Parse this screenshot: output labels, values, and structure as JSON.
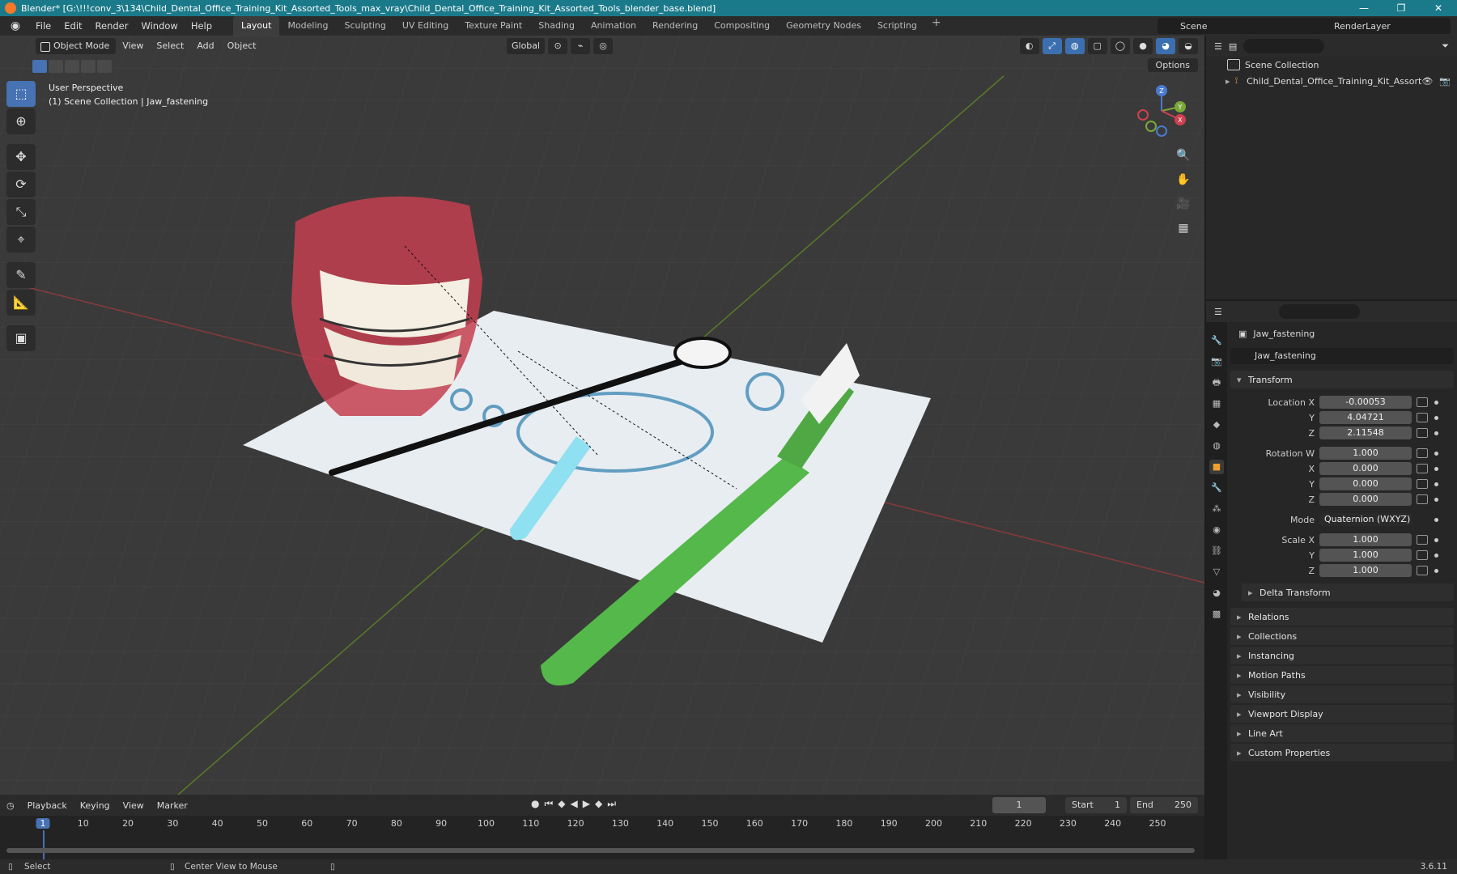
{
  "window": {
    "title": "Blender* [G:\\!!!conv_3\\134\\Child_Dental_Office_Training_Kit_Assorted_Tools_max_vray\\Child_Dental_Office_Training_Kit_Assorted_Tools_blender_base.blend]",
    "controls": [
      "—",
      "❐",
      "✕"
    ]
  },
  "menu": [
    "File",
    "Edit",
    "Render",
    "Window",
    "Help"
  ],
  "workspaces": [
    "Layout",
    "Modeling",
    "Sculpting",
    "UV Editing",
    "Texture Paint",
    "Shading",
    "Animation",
    "Rendering",
    "Compositing",
    "Geometry Nodes",
    "Scripting"
  ],
  "scene_name": "Scene",
  "render_layer": "RenderLayer",
  "viewport": {
    "mode": "Object Mode",
    "menus": [
      "View",
      "Select",
      "Add",
      "Object"
    ],
    "orientation": "Global",
    "options": "Options",
    "perspective": "User Perspective",
    "collection_info": "(1) Scene Collection | Jaw_fastening",
    "gizmo_axes": [
      "X",
      "Y",
      "Z"
    ]
  },
  "outliner": {
    "root": "Scene Collection",
    "items": [
      "Child_Dental_Office_Training_Kit_Assort"
    ]
  },
  "properties": {
    "object_name": "Jaw_fastening",
    "data_name": "Jaw_fastening",
    "transform_title": "Transform",
    "location_label": "Location X",
    "location": [
      "-0.00053",
      "4.04721",
      "2.11548"
    ],
    "rotation_label": "Rotation W",
    "rotation": [
      "1.000",
      "0.000",
      "0.000",
      "0.000"
    ],
    "mode_label": "Mode",
    "mode_value": "Quaternion (WXYZ)",
    "scale_label": "Scale X",
    "scale": [
      "1.000",
      "1.000",
      "1.000"
    ],
    "axis_y": "Y",
    "axis_z": "Z",
    "axis_x": "X",
    "delta_transform": "Delta Transform",
    "panels": [
      "Relations",
      "Collections",
      "Instancing",
      "Motion Paths",
      "Visibility",
      "Viewport Display",
      "Line Art",
      "Custom Properties"
    ]
  },
  "timeline": {
    "menus": [
      "Playback",
      "Keying",
      "View",
      "Marker"
    ],
    "current_frame": "1",
    "start_label": "Start",
    "start": "1",
    "end_label": "End",
    "end": "250",
    "ticks": [
      "1",
      "10",
      "20",
      "30",
      "40",
      "50",
      "60",
      "70",
      "80",
      "90",
      "100",
      "110",
      "120",
      "130",
      "140",
      "150",
      "160",
      "170",
      "180",
      "190",
      "200",
      "210",
      "220",
      "230",
      "240",
      "250"
    ]
  },
  "status": {
    "select": "Select",
    "center": "Center View to Mouse",
    "version": "3.6.11"
  },
  "colors": {
    "accent": "#4772b3",
    "title_bar": "#1b7a8a",
    "active_tab": "#f0a030"
  }
}
